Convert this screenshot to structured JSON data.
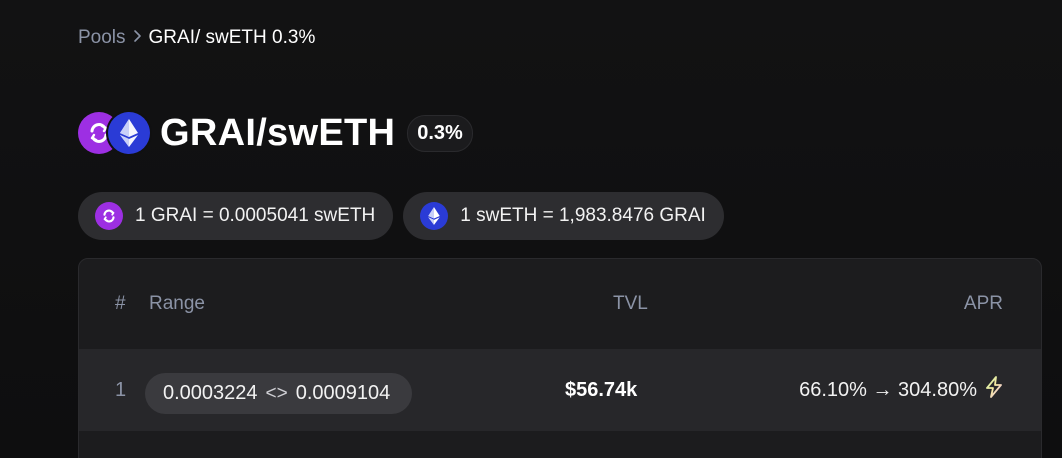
{
  "breadcrumb": {
    "parent": "Pools",
    "separator": ">",
    "current": "GRAI/ swETH 0.3%"
  },
  "pool": {
    "title": "GRAI/swETH",
    "fee": "0.3%",
    "token0_icon": "grai-token-icon",
    "token1_icon": "sweth-token-icon"
  },
  "prices": {
    "grai_to_sweth": "1 GRAI = 0.0005041 swETH",
    "sweth_to_grai": "1 swETH = 1,983.8476 GRAI"
  },
  "table": {
    "headers": {
      "num": "#",
      "range": "Range",
      "tvl": "TVL",
      "apr": "APR"
    },
    "rows": [
      {
        "num": "1",
        "range_min": "0.0003224",
        "range_sep": "<>",
        "range_max": "0.0009104",
        "tvl": "$56.74k",
        "apr": "66.10% → 304.80%",
        "apr_icon": "lightning-bolt-icon"
      }
    ]
  },
  "colors": {
    "grai": "#9d2fe3",
    "sweth": "#2a3bd6",
    "muted_text": "#8b93a6",
    "pill_bg": "#2d2d30"
  }
}
